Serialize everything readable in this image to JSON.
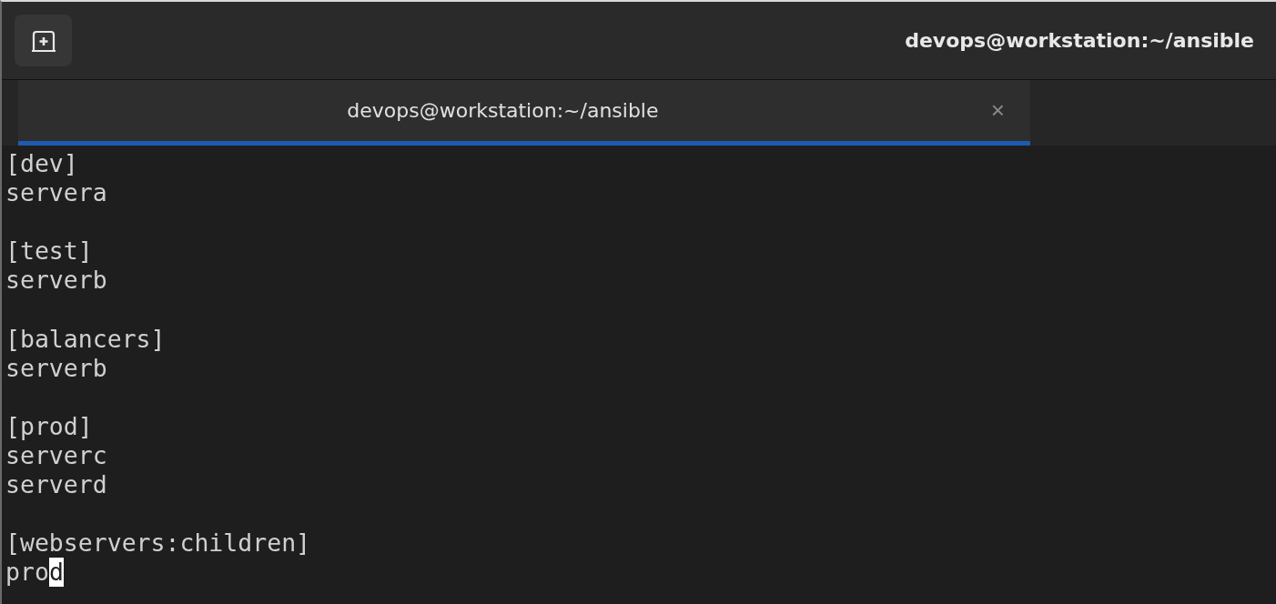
{
  "window": {
    "title": "devops@workstation:~/ansible"
  },
  "tabs": [
    {
      "label": "devops@workstation:~/ansible",
      "close": "×",
      "selected": true
    }
  ],
  "terminal": {
    "lines": [
      {
        "kind": "text",
        "text": "[dev]"
      },
      {
        "kind": "text",
        "text": "servera"
      },
      {
        "kind": "blank"
      },
      {
        "kind": "text",
        "text": "[test]"
      },
      {
        "kind": "text",
        "text": "serverb"
      },
      {
        "kind": "blank"
      },
      {
        "kind": "text",
        "text": "[balancers]"
      },
      {
        "kind": "text",
        "text": "serverb"
      },
      {
        "kind": "blank"
      },
      {
        "kind": "text",
        "text": "[prod]"
      },
      {
        "kind": "text",
        "text": "serverc"
      },
      {
        "kind": "text",
        "text": "serverd"
      },
      {
        "kind": "blank"
      },
      {
        "kind": "text",
        "text": "[webservers:children]"
      },
      {
        "kind": "cursor",
        "text": "pro",
        "cursor": "d"
      }
    ]
  }
}
